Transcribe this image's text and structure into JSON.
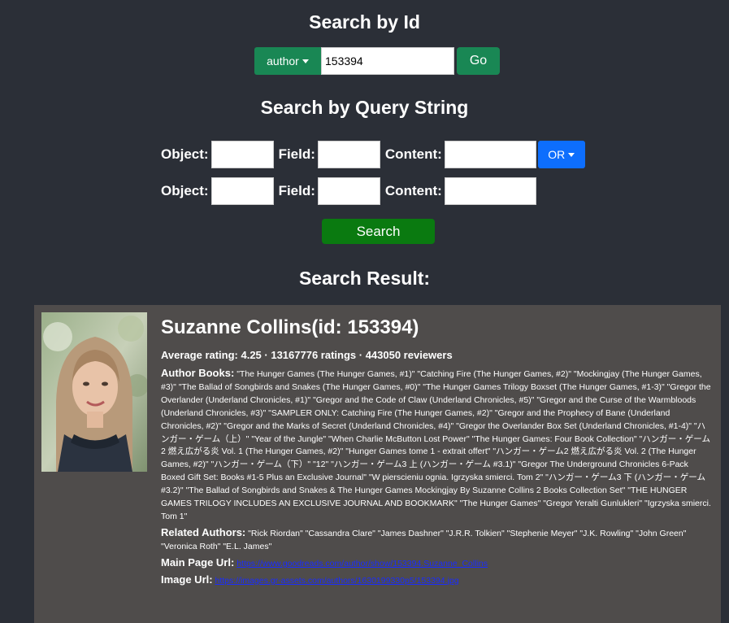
{
  "search_by_id": {
    "heading": "Search by Id",
    "type_dropdown": "author",
    "id_value": "153394",
    "go_label": "Go"
  },
  "search_by_query": {
    "heading": "Search by Query String",
    "object_label": "Object:",
    "field_label": "Field:",
    "content_label": "Content:",
    "operator": "OR",
    "search_label": "Search"
  },
  "result": {
    "heading": "Search Result:",
    "name": "Suzanne Collins(id: 153394)",
    "stats": "Average rating: 4.25 · 13167776 ratings · 443050 reviewers",
    "author_books_label": "Author Books:",
    "author_books": "\"The Hunger Games (The Hunger Games, #1)\" \"Catching Fire (The Hunger Games, #2)\" \"Mockingjay (The Hunger Games, #3)\" \"The Ballad of Songbirds and Snakes (The Hunger Games, #0)\" \"The Hunger Games Trilogy Boxset (The Hunger Games, #1-3)\" \"Gregor the Overlander (Underland Chronicles, #1)\" \"Gregor and the Code of Claw (Underland Chronicles, #5)\" \"Gregor and the Curse of the Warmbloods (Underland Chronicles, #3)\" \"SAMPLER ONLY: Catching Fire (The Hunger Games, #2)\" \"Gregor and the Prophecy of Bane (Underland Chronicles, #2)\" \"Gregor and the Marks of Secret (Underland Chronicles, #4)\" \"Gregor the Overlander Box Set (Underland Chronicles, #1-4)\" \"ハンガー・ゲーム（上）\" \"Year of the Jungle\" \"When Charlie McButton Lost Power\" \"The Hunger Games: Four Book Collection\" \"ハンガー・ゲーム2 燃え広がる炎 Vol. 1 (The Hunger Games, #2)\" \"Hunger Games tome 1 - extrait offert\" \"ハンガー・ゲーム2 燃え広がる炎 Vol. 2 (The Hunger Games, #2)\" \"ハンガー・ゲーム（下）\" \"12\" \"ハンガー・ゲーム3 上 (ハンガー・ゲーム #3.1)\" \"Gregor The Underground Chronicles 6-Pack Boxed Gift Set: Books #1-5 Plus an Exclusive Journal\" \"W pierscieniu ognia. Igrzyska smierci. Tom 2\" \"ハンガー・ゲーム3 下 (ハンガー・ゲーム #3.2)\" \"The Ballad of Songbirds and Snakes & The Hunger Games Mockingjay By Suzanne Collins 2 Books Collection Set\" \"THE HUNGER GAMES TRILOGY INCLUDES AN EXCLUSIVE JOURNAL AND BOOKMARK\" \"The Hunger Games\" \"Gregor Yeralti Gunlukleri\" \"Igrzyska smierci. Tom 1\"",
    "related_authors_label": "Related Authors:",
    "related_authors": "\"Rick Riordan\" \"Cassandra Clare\" \"James Dashner\" \"J.R.R. Tolkien\" \"Stephenie Meyer\" \"J.K. Rowling\" \"John Green\" \"Veronica Roth\" \"E.L. James\"",
    "main_page_label": "Main Page Url:",
    "main_page_url": "https://www.goodreads.com/author/show/153394.Suzanne_Collins",
    "image_label": "Image Url:",
    "image_url": "https://images.gr-assets.com/authors/1630199330p5/153394.jpg"
  },
  "colors": {
    "background": "#2b2f37",
    "green_button": "#198754",
    "search_button": "#0a7a10",
    "or_button": "#0d6efd",
    "result_panel": "#4f4c4b",
    "link": "#1a2cff"
  }
}
